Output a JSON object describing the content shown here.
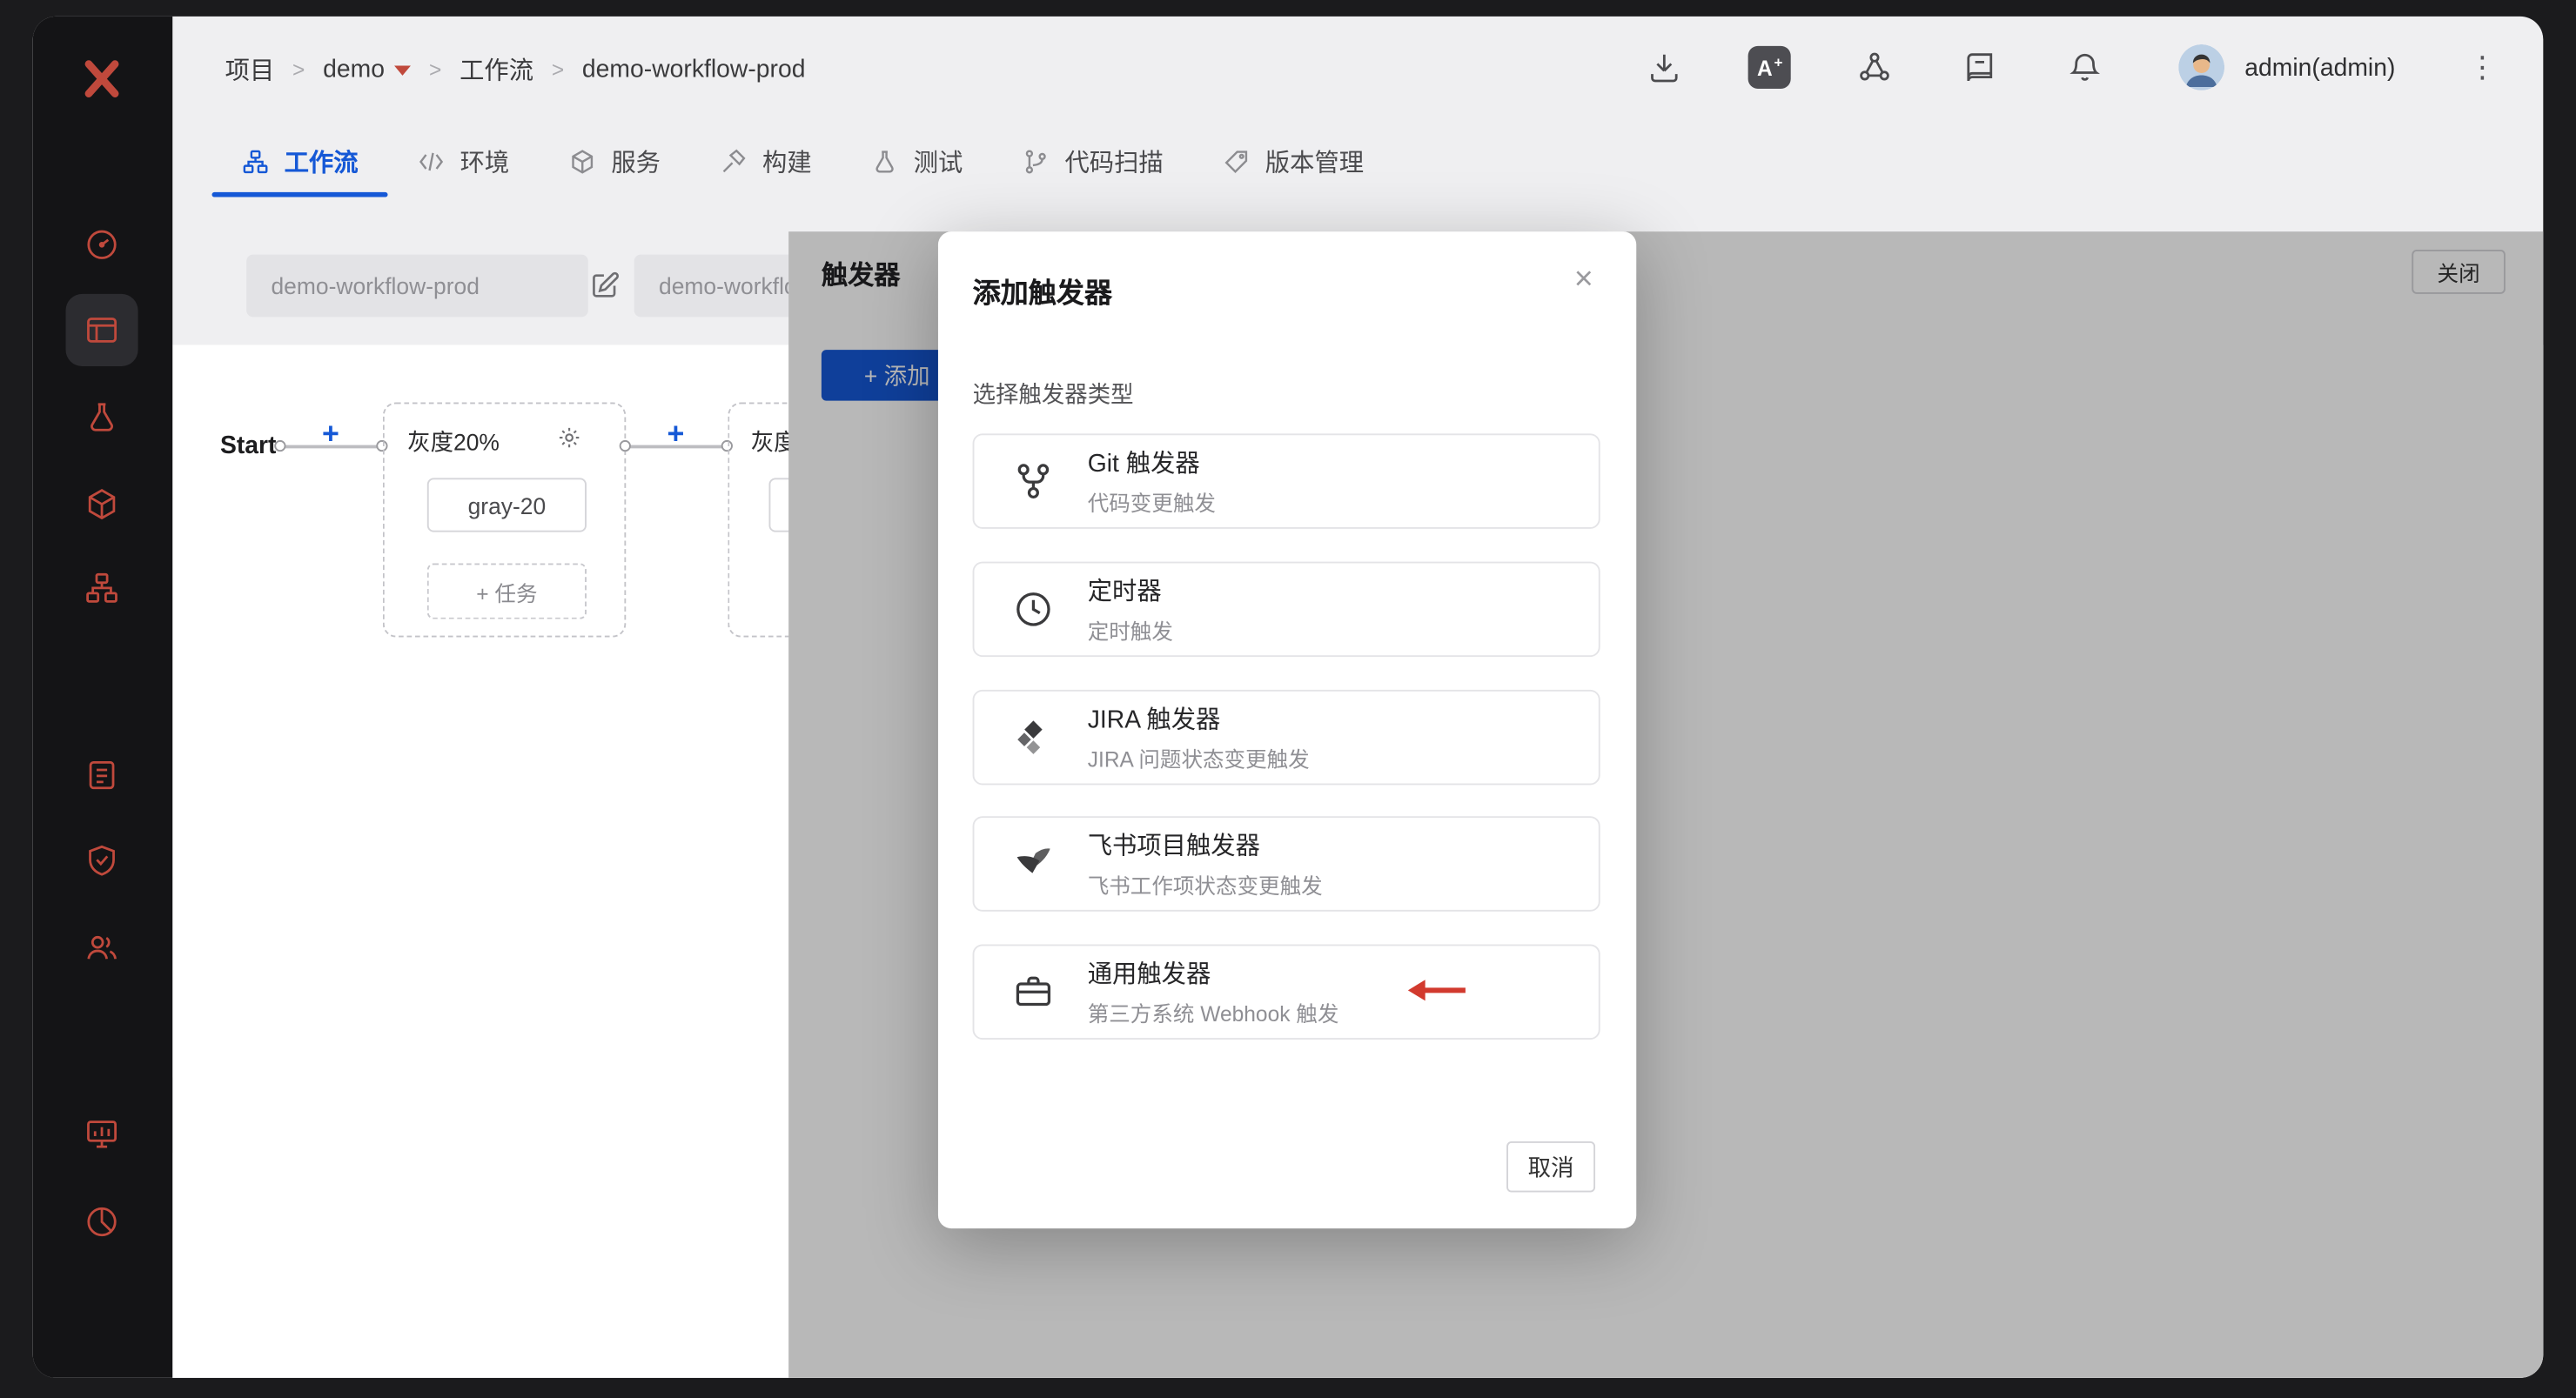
{
  "icons": {
    "chevron_right": "›",
    "kebab": "⋮"
  },
  "header": {
    "breadcrumb": [
      "项目",
      "demo",
      "工作流",
      "demo-workflow-prod"
    ],
    "sep": ">",
    "badge_a": "A",
    "badge_plus": "+",
    "user": "admin(admin)"
  },
  "tabs": [
    {
      "label": "工作流"
    },
    {
      "label": "环境"
    },
    {
      "label": "服务"
    },
    {
      "label": "构建"
    },
    {
      "label": "测试"
    },
    {
      "label": "代码扫描"
    },
    {
      "label": "版本管理"
    }
  ],
  "workflow": {
    "name_value": "demo-workflow-prod",
    "name_value_2": "demo-workflo",
    "start_label": "Start",
    "plus": "+",
    "node1_title": "灰度20%",
    "node1_job": "gray-20",
    "node1_add_task": "+ 任务",
    "node2_title": "灰度"
  },
  "drawer": {
    "title": "触发器",
    "close_label": "关闭",
    "add_label": "+ 添加"
  },
  "modal": {
    "title": "添加触发器",
    "close_glyph": "×",
    "prompt": "选择触发器类型",
    "options": [
      {
        "title": "Git 触发器",
        "desc": "代码变更触发"
      },
      {
        "title": "定时器",
        "desc": "定时触发"
      },
      {
        "title": "JIRA 触发器",
        "desc": "JIRA 问题状态变更触发"
      },
      {
        "title": "飞书项目触发器",
        "desc": "飞书工作项状态变更触发"
      },
      {
        "title": "通用触发器",
        "desc": "第三方系统 Webhook 触发"
      }
    ],
    "cancel_label": "取消"
  },
  "colors": {
    "accent": "#1558d6",
    "brand_red": "#c0493c",
    "annotation_red": "#d23a2e"
  }
}
